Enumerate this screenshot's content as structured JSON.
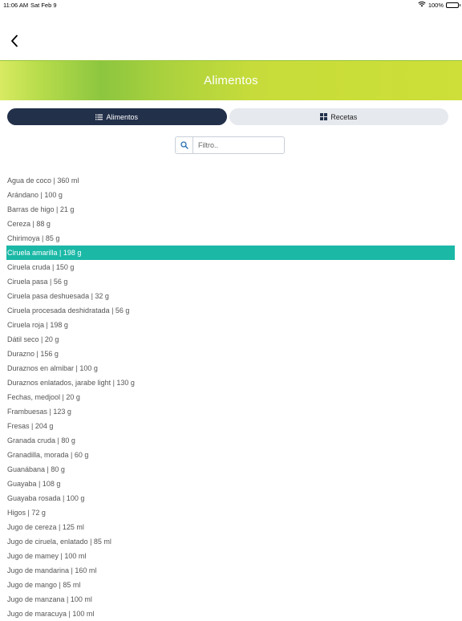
{
  "status": {
    "time": "11:06 AM",
    "date": "Sat Feb 9",
    "battery": "100%"
  },
  "header": {
    "title": "Alimentos"
  },
  "tabs": [
    {
      "label": "Alimentos",
      "icon": "list-icon",
      "active": true
    },
    {
      "label": "Recetas",
      "icon": "grid-icon",
      "active": false
    }
  ],
  "search": {
    "placeholder": "Filtro.."
  },
  "colors": {
    "selected": "#1bb8a6",
    "tab_active": "#22304a"
  },
  "foods": [
    {
      "label": "Agua de coco | 360 ml"
    },
    {
      "label": "Arándano | 100 g"
    },
    {
      "label": "Barras de higo | 21 g"
    },
    {
      "label": "Cereza | 88 g"
    },
    {
      "label": "Chirimoya | 85 g"
    },
    {
      "label": "Ciruela amarilla | 198 g",
      "selected": true
    },
    {
      "label": "Ciruela cruda | 150 g"
    },
    {
      "label": "Ciruela pasa | 56 g"
    },
    {
      "label": "Ciruela pasa deshuesada | 32 g"
    },
    {
      "label": "Ciruela procesada deshidratada | 56 g"
    },
    {
      "label": "Ciruela roja | 198 g"
    },
    {
      "label": "Dátil seco | 20 g"
    },
    {
      "label": "Durazno | 156 g"
    },
    {
      "label": "Duraznos en almibar | 100 g"
    },
    {
      "label": "Duraznos enlatados, jarabe light | 130 g"
    },
    {
      "label": "Fechas, medjool | 20 g"
    },
    {
      "label": "Frambuesas | 123 g"
    },
    {
      "label": "Fresas | 204 g"
    },
    {
      "label": "Granada cruda | 80 g"
    },
    {
      "label": "Granadilla, morada | 60 g"
    },
    {
      "label": "Guanábana | 80 g"
    },
    {
      "label": "Guayaba | 108 g"
    },
    {
      "label": "Guayaba rosada | 100 g"
    },
    {
      "label": "Higos | 72 g"
    },
    {
      "label": "Jugo de cereza | 125 ml"
    },
    {
      "label": "Jugo de ciruela, enlatado | 85 ml"
    },
    {
      "label": "Jugo de mamey | 100 ml"
    },
    {
      "label": "Jugo de mandarina | 160 ml"
    },
    {
      "label": "Jugo de mango | 85 ml"
    },
    {
      "label": "Jugo de manzana | 100 ml"
    },
    {
      "label": "Jugo de maracuya | 100 ml"
    }
  ]
}
